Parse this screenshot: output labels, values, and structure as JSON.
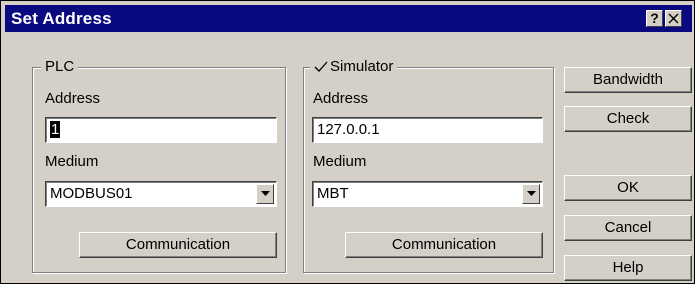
{
  "window": {
    "title": "Set Address",
    "help_button": "?",
    "close_icon": "close-icon"
  },
  "plc": {
    "legend": "PLC",
    "address_label": "Address",
    "address_value": "1",
    "medium_label": "Medium",
    "medium_value": "MODBUS01",
    "communication_button": "Communication"
  },
  "simulator": {
    "checked": true,
    "legend": "Simulator",
    "address_label": "Address",
    "address_value": "127.0.0.1",
    "medium_label": "Medium",
    "medium_value": "MBT",
    "communication_button": "Communication"
  },
  "buttons": {
    "bandwidth": "Bandwidth",
    "check": "Check",
    "ok": "OK",
    "cancel": "Cancel",
    "help": "Help"
  },
  "colors": {
    "titlebar": "#0a0a80",
    "face": "#d4d0c8"
  }
}
